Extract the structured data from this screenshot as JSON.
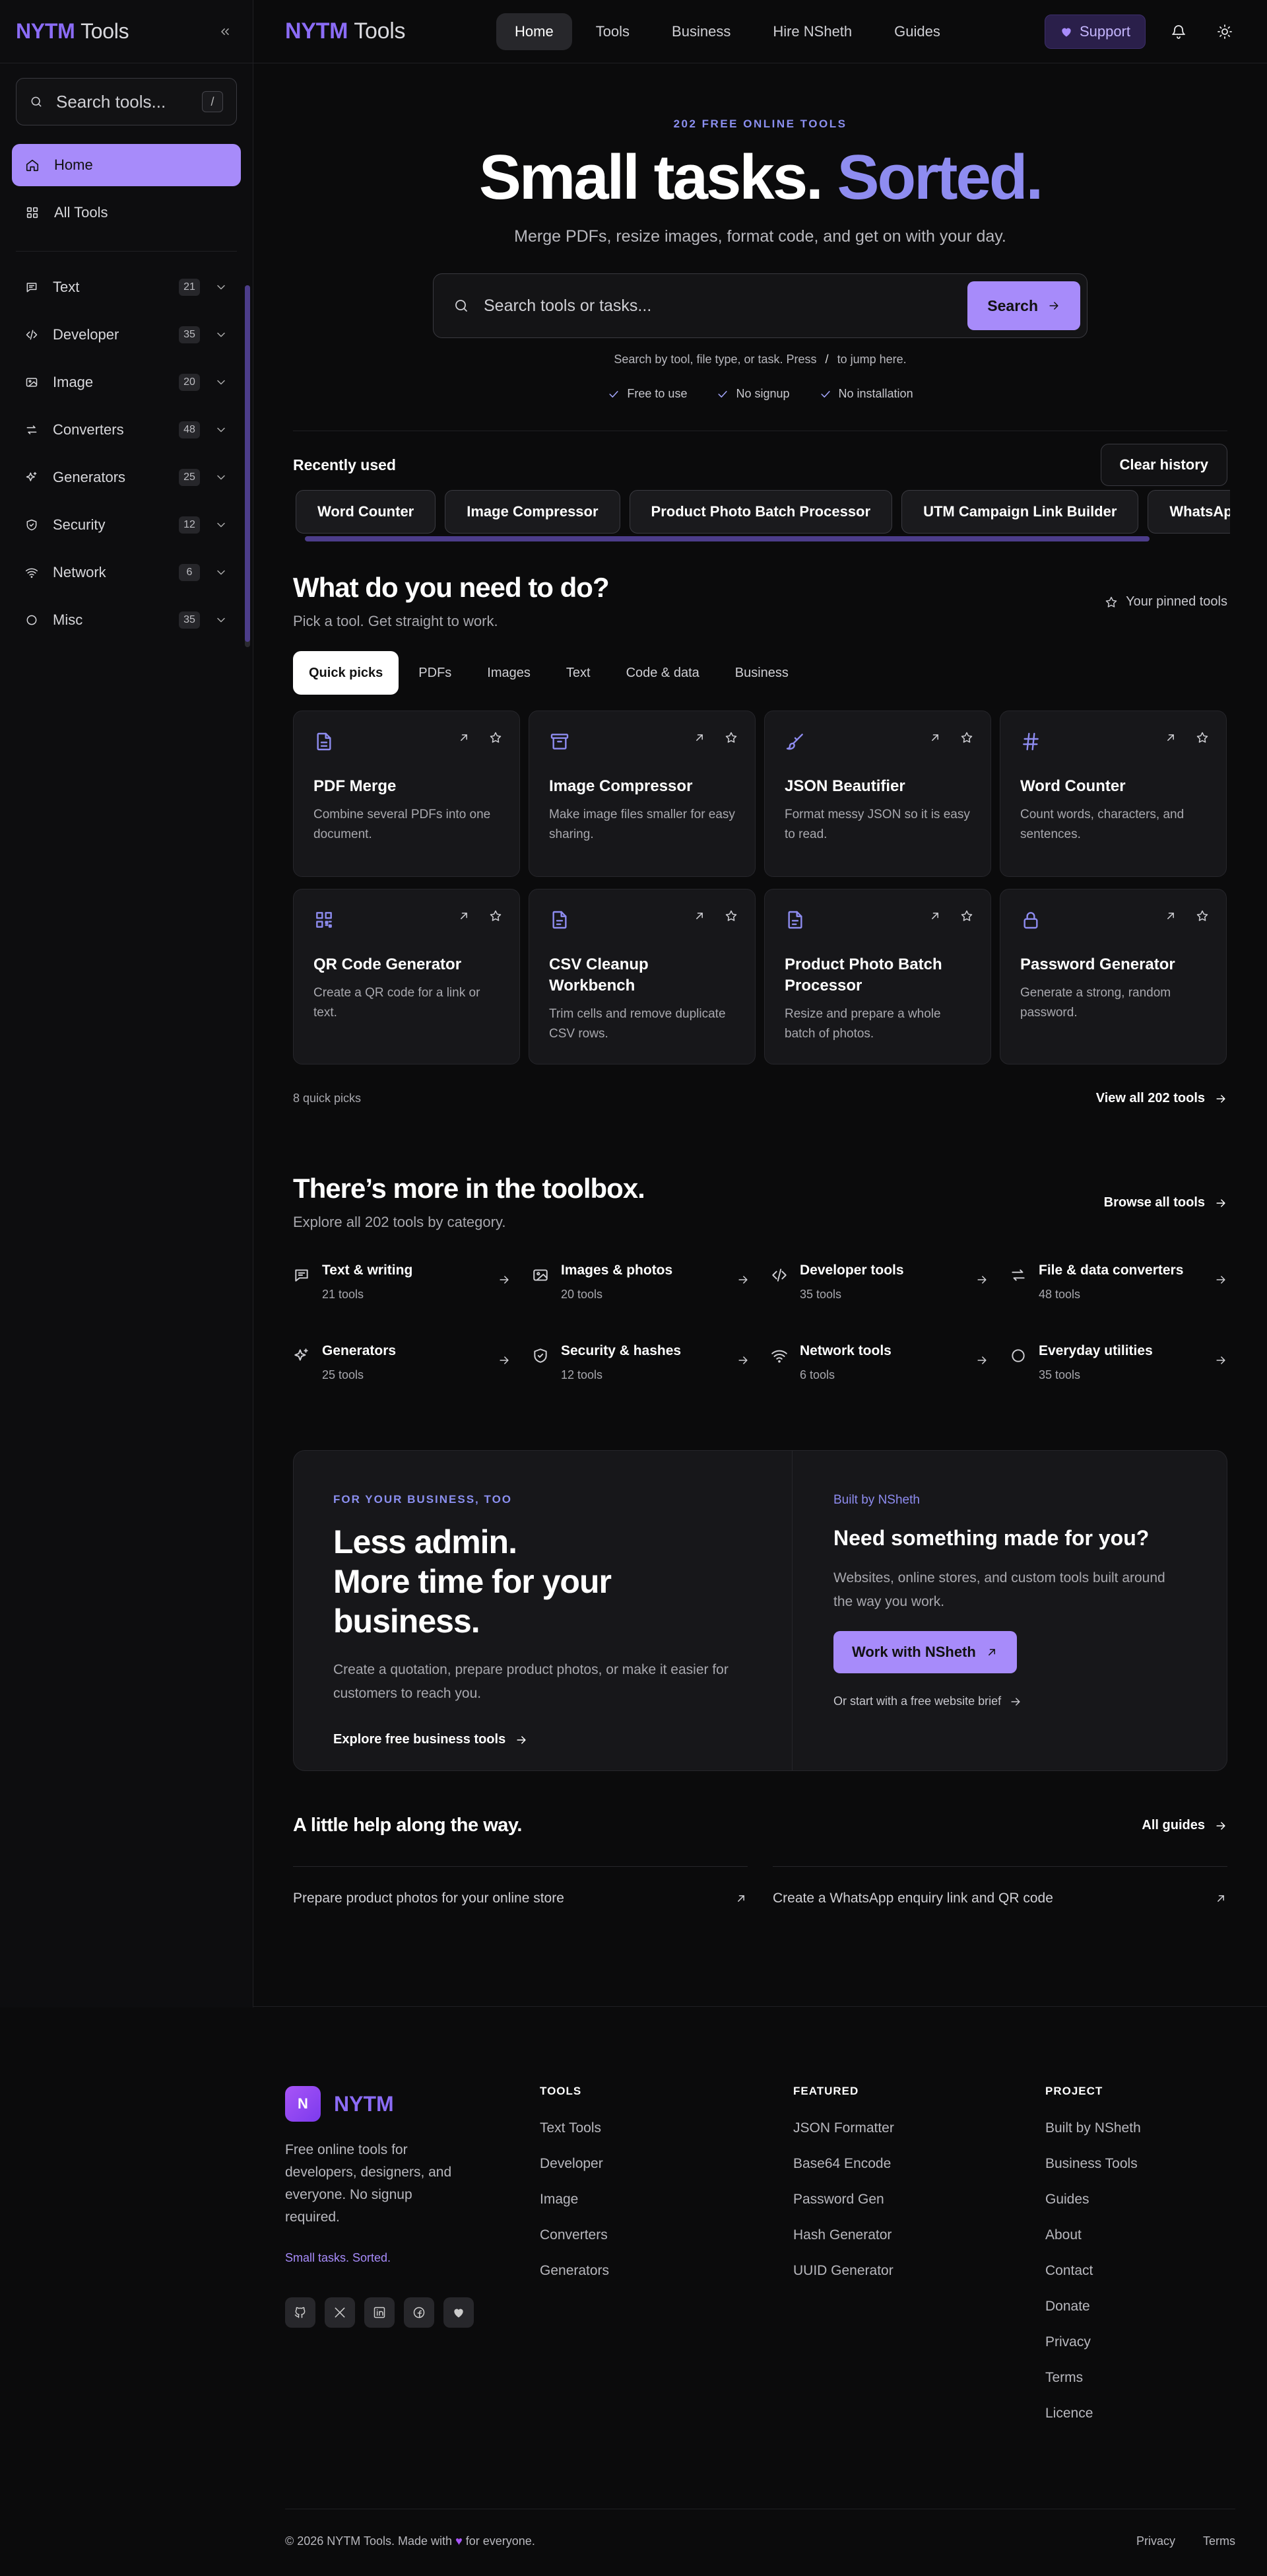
{
  "brand": {
    "part1": "NYTM",
    "part2": "Tools"
  },
  "sidebar": {
    "search_placeholder": "Search tools...",
    "search_kbd": "/",
    "nav": [
      {
        "label": "Home"
      },
      {
        "label": "All Tools"
      }
    ],
    "categories": [
      {
        "label": "Text",
        "count": "21"
      },
      {
        "label": "Developer",
        "count": "35"
      },
      {
        "label": "Image",
        "count": "20"
      },
      {
        "label": "Converters",
        "count": "48"
      },
      {
        "label": "Generators",
        "count": "25"
      },
      {
        "label": "Security",
        "count": "12"
      },
      {
        "label": "Network",
        "count": "6"
      },
      {
        "label": "Misc",
        "count": "35"
      }
    ]
  },
  "topnav": {
    "links": [
      "Home",
      "Tools",
      "Business",
      "Hire NSheth",
      "Guides"
    ],
    "support": "Support"
  },
  "hero": {
    "eyebrow": "202 FREE ONLINE TOOLS",
    "title_a": "Small tasks.",
    "title_b": "Sorted.",
    "subtitle": "Merge PDFs, resize images, format code, and get on with your day.",
    "search_placeholder": "Search tools or tasks...",
    "search_button": "Search",
    "hint_a": "Search by tool, file type, or task. Press",
    "hint_key": "/",
    "hint_b": "to jump here.",
    "checks": [
      "Free to use",
      "No signup",
      "No installation"
    ]
  },
  "recent": {
    "title": "Recently used",
    "clear": "Clear history",
    "chips": [
      "Word Counter",
      "Image Compressor",
      "Product Photo Batch Processor",
      "UTM Campaign Link Builder",
      "WhatsApp Link & QR"
    ]
  },
  "picks": {
    "title": "What do you need to do?",
    "subtitle": "Pick a tool. Get straight to work.",
    "pinned": "Your pinned tools",
    "tabs": [
      "Quick picks",
      "PDFs",
      "Images",
      "Text",
      "Code & data",
      "Business"
    ],
    "cards": [
      {
        "icon": "file-icon",
        "title": "PDF Merge",
        "desc": "Combine several PDFs into one document."
      },
      {
        "icon": "archive-icon",
        "title": "Image Compressor",
        "desc": "Make image files smaller for easy sharing."
      },
      {
        "icon": "brush-icon",
        "title": "JSON Beautifier",
        "desc": "Format messy JSON so it is easy to read."
      },
      {
        "icon": "hash-icon",
        "title": "Word Counter",
        "desc": "Count words, characters, and sentences."
      },
      {
        "icon": "qr-icon",
        "title": "QR Code Generator",
        "desc": "Create a QR code for a link or text."
      },
      {
        "icon": "file-text-icon",
        "title": "CSV Cleanup Workbench",
        "desc": "Trim cells and remove duplicate CSV rows."
      },
      {
        "icon": "file-text-icon",
        "title": "Product Photo Batch Processor",
        "desc": "Resize and prepare a whole batch of photos."
      },
      {
        "icon": "lock-icon",
        "title": "Password Generator",
        "desc": "Generate a strong, random password."
      }
    ],
    "count_text": "8 quick picks",
    "view_all": "View all 202 tools"
  },
  "toolbox": {
    "title": "There’s more in the toolbox.",
    "subtitle": "Explore all 202 tools by category.",
    "browse": "Browse all tools",
    "categories": [
      {
        "icon": "message-icon",
        "name": "Text & writing",
        "count": "21 tools"
      },
      {
        "icon": "image-icon",
        "name": "Images & photos",
        "count": "20 tools"
      },
      {
        "icon": "code-icon",
        "name": "Developer tools",
        "count": "35 tools"
      },
      {
        "icon": "swap-icon",
        "name": "File & data converters",
        "count": "48 tools"
      },
      {
        "icon": "sparkles-icon",
        "name": "Generators",
        "count": "25 tools"
      },
      {
        "icon": "shield-icon",
        "name": "Security & hashes",
        "count": "12 tools"
      },
      {
        "icon": "wifi-icon",
        "name": "Network tools",
        "count": "6 tools"
      },
      {
        "icon": "circle-icon",
        "name": "Everyday utilities",
        "count": "35 tools"
      }
    ]
  },
  "business": {
    "eyebrow": "FOR YOUR BUSINESS, TOO",
    "title_l1": "Less admin.",
    "title_l2": "More time for your business.",
    "text": "Create a quotation, prepare product photos, or make it easier for customers to reach you.",
    "link": "Explore free business tools",
    "r_eyebrow": "Built by NSheth",
    "r_title": "Need something made for you?",
    "r_text": "Websites, online stores, and custom tools built around the way you work.",
    "cta": "Work with NSheth",
    "r_link": "Or start with a free website brief"
  },
  "guides": {
    "title": "A little help along the way.",
    "all": "All guides",
    "items": [
      "Prepare product photos for your online store",
      "Create a WhatsApp enquiry link and QR code"
    ]
  },
  "footer": {
    "logo_letter": "N",
    "name": "NYTM",
    "desc": "Free online tools for developers, designers, and everyone. No signup required.",
    "tagline": "Small tasks. Sorted.",
    "cols": [
      {
        "title": "TOOLS",
        "items": [
          "Text Tools",
          "Developer",
          "Image",
          "Converters",
          "Generators"
        ]
      },
      {
        "title": "FEATURED",
        "items": [
          "JSON Formatter",
          "Base64 Encode",
          "Password Gen",
          "Hash Generator",
          "UUID Generator"
        ]
      },
      {
        "title": "PROJECT",
        "items": [
          "Built by NSheth",
          "Business Tools",
          "Guides",
          "About",
          "Contact",
          "Donate",
          "Privacy",
          "Terms",
          "Licence"
        ]
      }
    ],
    "copy_a": "© 2026 NYTM Tools. Made with",
    "copy_b": "for everyone.",
    "bottom_links": [
      "Privacy",
      "Terms"
    ]
  },
  "colors": {
    "accent": "#a78bfa",
    "accent_text": "#8e8cf0",
    "bg": "#0b0b0c",
    "card": "#17171a"
  }
}
